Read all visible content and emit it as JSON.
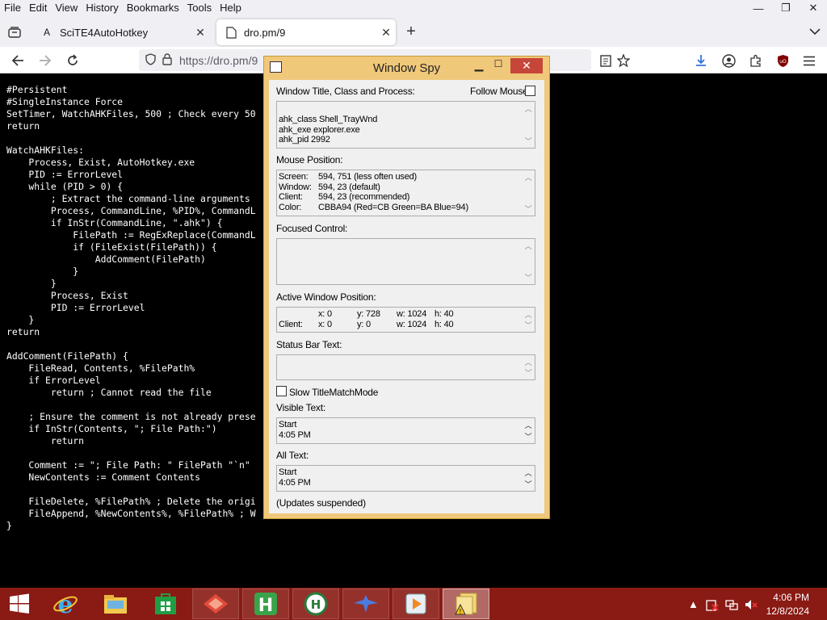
{
  "menubar": {
    "items": [
      "File",
      "Edit",
      "View",
      "History",
      "Bookmarks",
      "Tools",
      "Help"
    ],
    "accel": [
      "F",
      "E",
      "V",
      "H",
      "B",
      "T",
      "H"
    ]
  },
  "window_controls": {
    "minimize": "—",
    "restore": "❐",
    "close": "✕"
  },
  "tabs": [
    {
      "title": "SciTE4AutoHotkey",
      "icon": "letter-a-icon",
      "active": false
    },
    {
      "title": "dro.pm/9",
      "icon": "page-icon",
      "active": true
    }
  ],
  "navbar": {
    "url": "https://dro.pm/9"
  },
  "code_lines": [
    "#Persistent",
    "#SingleInstance Force",
    "SetTimer, WatchAHKFiles, 500 ; Check every 50",
    "return",
    "",
    "WatchAHKFiles:",
    "    Process, Exist, AutoHotkey.exe",
    "    PID := ErrorLevel",
    "    while (PID > 0) {",
    "        ; Extract the command-line arguments",
    "        Process, CommandLine, %PID%, CommandL",
    "        if InStr(CommandLine, \".ahk\") {",
    "            FilePath := RegExReplace(CommandL",
    "            if (FileExist(FilePath)) {",
    "                AddComment(FilePath)",
    "            }",
    "        }",
    "        Process, Exist",
    "        PID := ErrorLevel",
    "    }",
    "return",
    "",
    "AddComment(FilePath) {",
    "    FileRead, Contents, %FilePath%",
    "    if ErrorLevel",
    "        return ; Cannot read the file",
    "",
    "    ; Ensure the comment is not already prese",
    "    if InStr(Contents, \"; File Path:\")",
    "        return",
    "",
    "    Comment := \"; File Path: \" FilePath \"`n\"",
    "    NewContents := Comment Contents",
    "",
    "    FileDelete, %FilePath% ; Delete the origi",
    "    FileAppend, %NewContents%, %FilePath% ; W",
    "}"
  ],
  "spy": {
    "title": "Window Spy",
    "section_title_label": "Window Title, Class and Process:",
    "follow_mouse_label": "Follow Mouse",
    "title_lines": [
      "ahk_class Shell_TrayWnd",
      "ahk_exe explorer.exe",
      "ahk_pid 2992"
    ],
    "mouse_label": "Mouse Position:",
    "mouse_rows": [
      {
        "k": "Screen:",
        "v": "594, 751 (less often used)"
      },
      {
        "k": "Window:",
        "v": "594, 23 (default)"
      },
      {
        "k": "Client:",
        "v": "594, 23 (recommended)"
      },
      {
        "k": "Color:",
        "v": "CBBA94 (Red=CB Green=BA Blue=94)"
      }
    ],
    "focused_label": "Focused Control:",
    "active_label": "Active Window Position:",
    "active_rows": [
      {
        "k": "",
        "x": "x: 0",
        "y": "y: 728",
        "w": "w: 1024",
        "h": "h: 40"
      },
      {
        "k": "Client:",
        "x": "x: 0",
        "y": "y: 0",
        "w": "w: 1024",
        "h": "h: 40"
      }
    ],
    "status_label": "Status Bar Text:",
    "slow_label": "Slow TitleMatchMode",
    "visible_label": "Visible Text:",
    "visible_lines": [
      "Start",
      "4:05 PM"
    ],
    "all_label": "All Text:",
    "all_lines": [
      "Start",
      "4:05 PM"
    ],
    "footer": "(Updates suspended)"
  },
  "taskbar": {
    "apps": [
      "start-button",
      "internet-explorer-icon",
      "file-explorer-icon",
      "store-icon",
      "app-red-icon",
      "app-h-icon",
      "app-globe-icon",
      "app-bird-icon",
      "media-player-icon",
      "window-spy-task-icon"
    ],
    "clock_time": "4:06 PM",
    "clock_date": "12/8/2024",
    "colors": {
      "bar": "#8a1a14"
    }
  }
}
